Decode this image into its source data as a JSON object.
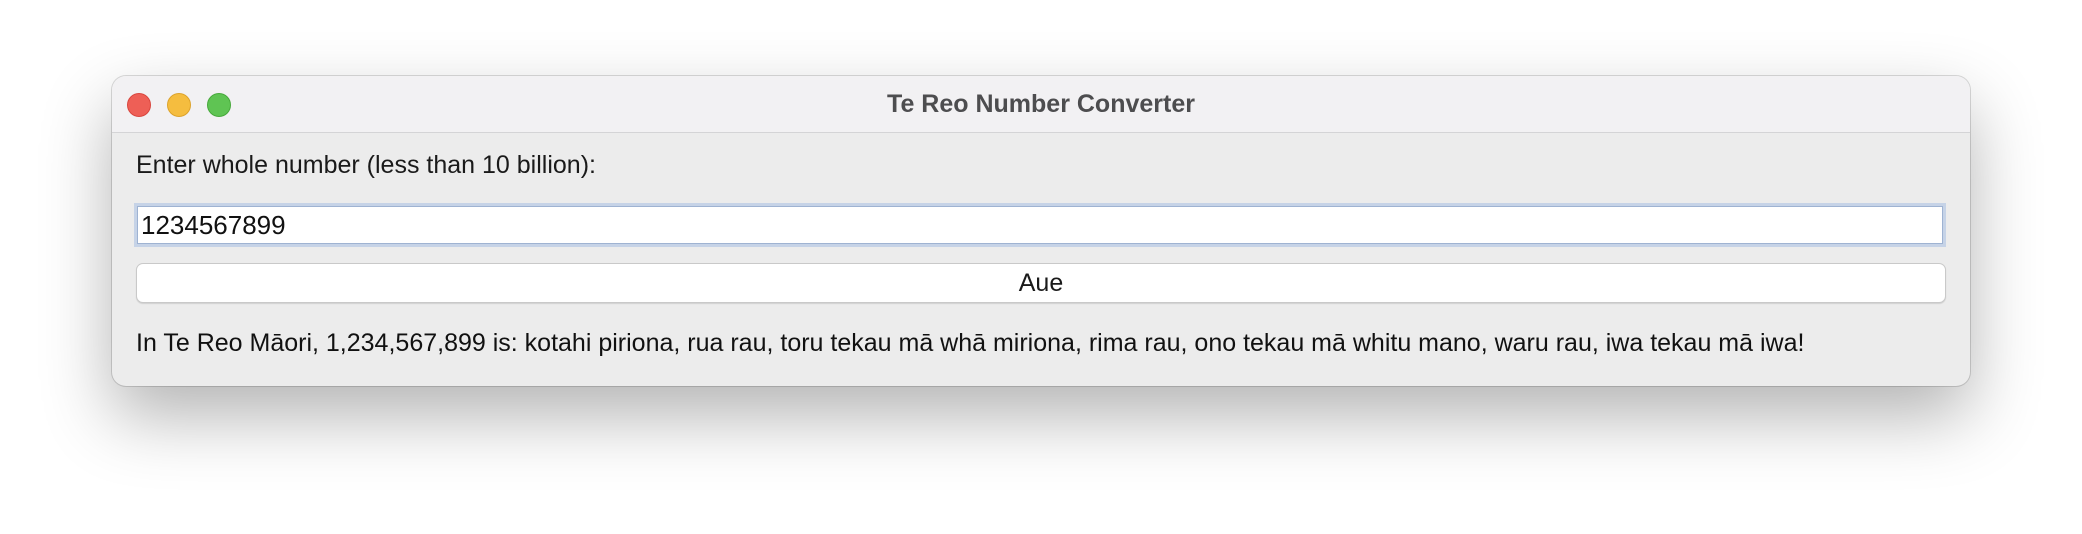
{
  "window": {
    "title": "Te Reo Number Converter"
  },
  "form": {
    "prompt_label": "Enter whole number (less than 10 billion):",
    "number_value": "1234567899",
    "convert_button_label": "Aue"
  },
  "result": {
    "text": "In Te Reo Māori, 1,234,567,899 is: kotahi piriona, rua rau, toru tekau mā whā miriona, rima rau, ono tekau mā whitu mano, waru rau, iwa tekau mā iwa!"
  },
  "icons": {
    "close": "close-icon",
    "minimize": "minimize-icon",
    "zoom": "zoom-icon"
  },
  "colors": {
    "close": "#ee5f56",
    "minimize": "#f5bd3f",
    "zoom": "#5fc453",
    "window_bg": "#ececec",
    "focus_ring": "#c6d3e7"
  }
}
